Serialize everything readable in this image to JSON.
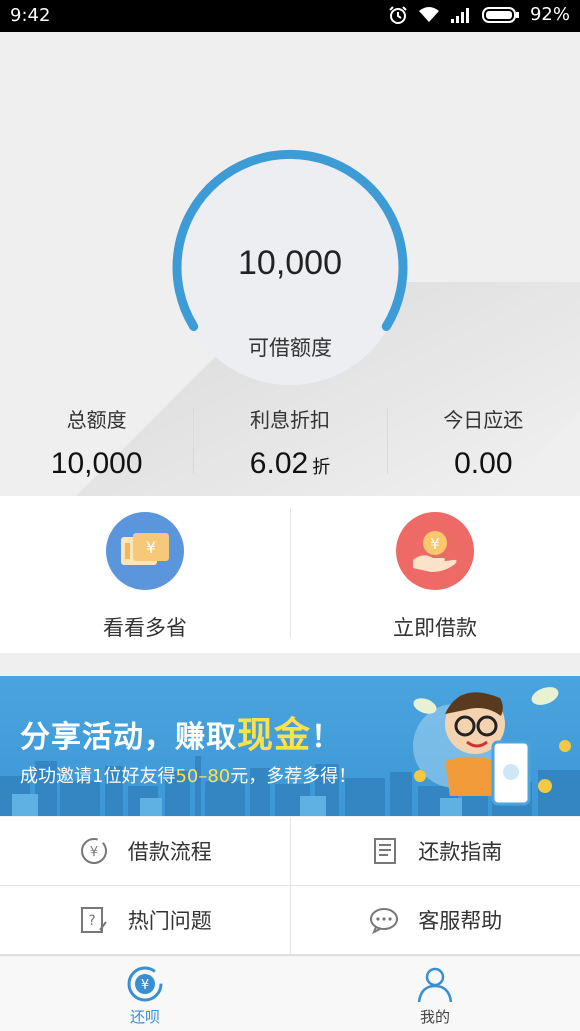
{
  "status_bar": {
    "time": "9:42",
    "battery": "92%",
    "icons": [
      "alarm-icon",
      "wifi-icon",
      "signal-icon",
      "battery-icon"
    ]
  },
  "credit": {
    "available_amount": "10,000",
    "available_label": "可借额度",
    "gauge_color": "#3d9bd6"
  },
  "stats": [
    {
      "label": "总额度",
      "value": "10,000",
      "unit": ""
    },
    {
      "label": "利息折扣",
      "value": "6.02",
      "unit": "折"
    },
    {
      "label": "今日应还",
      "value": "0.00",
      "unit": ""
    }
  ],
  "actions": {
    "left": {
      "label": "看看多省",
      "icon": "coupon-icon",
      "color": "#5b95db"
    },
    "right": {
      "label": "立即借款",
      "icon": "hand-coin-icon",
      "color": "#ee6a66"
    }
  },
  "banner": {
    "title_prefix": "分享活动，赚取",
    "title_highlight": "现金",
    "title_suffix": "！",
    "sub_prefix": "成功邀请1位好友得",
    "sub_highlight": "50–80",
    "sub_suffix": "元，多荐多得！"
  },
  "menu": [
    {
      "label": "借款流程",
      "icon": "yen-cycle-icon"
    },
    {
      "label": "还款指南",
      "icon": "scroll-icon"
    },
    {
      "label": "热门问题",
      "icon": "question-icon"
    },
    {
      "label": "客服帮助",
      "icon": "chat-icon"
    }
  ],
  "tabs": [
    {
      "label": "还呗",
      "icon": "yen-tab-icon",
      "active": true
    },
    {
      "label": "我的",
      "icon": "person-icon",
      "active": false
    }
  ],
  "colors": {
    "accent": "#3a8fd3",
    "highlight": "#ffe14a"
  }
}
